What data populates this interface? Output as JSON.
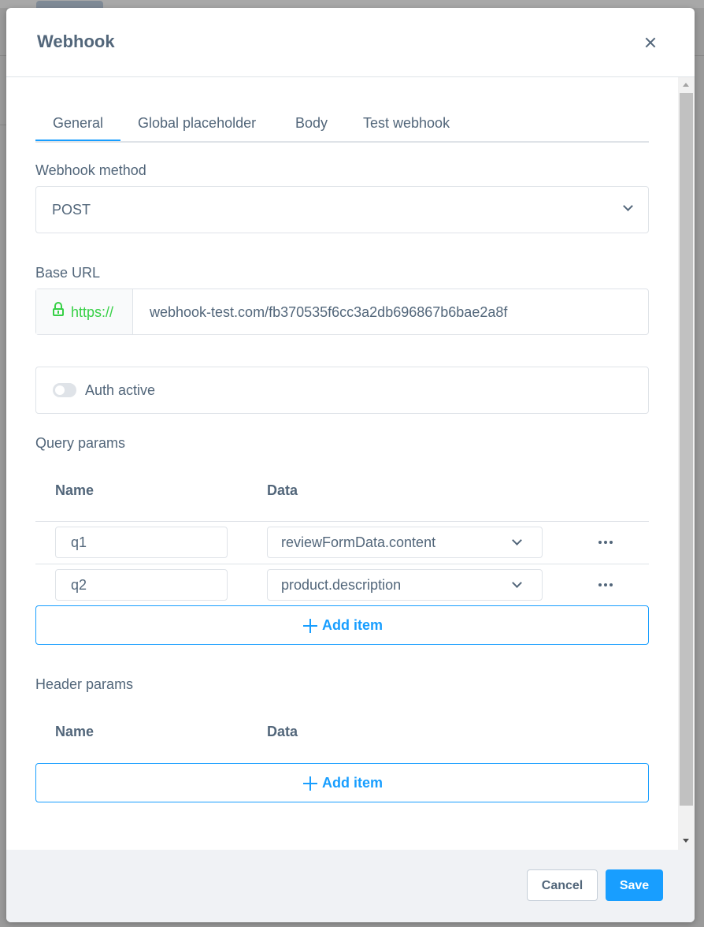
{
  "modal": {
    "title": "Webhook"
  },
  "tabs": [
    {
      "label": "General",
      "active": true
    },
    {
      "label": "Global placeholder",
      "active": false
    },
    {
      "label": "Body",
      "active": false
    },
    {
      "label": "Test webhook",
      "active": false
    }
  ],
  "method": {
    "label": "Webhook method",
    "value": "POST"
  },
  "base_url": {
    "label": "Base URL",
    "prefix": "https://",
    "value": "webhook-test.com/fb370535f6cc3a2db696867b6bae2a8f"
  },
  "auth": {
    "label": "Auth active",
    "enabled": false
  },
  "query_params": {
    "title": "Query params",
    "col_name": "Name",
    "col_data": "Data",
    "rows": [
      {
        "name": "q1",
        "data": "reviewFormData.content"
      },
      {
        "name": "q2",
        "data": "product.description"
      }
    ],
    "add_label": "Add item"
  },
  "header_params": {
    "title": "Header params",
    "col_name": "Name",
    "col_data": "Data",
    "add_label": "Add item"
  },
  "footer": {
    "cancel_label": "Cancel",
    "save_label": "Save"
  },
  "colors": {
    "primary": "#189eff",
    "text": "#52667a",
    "secure": "#37d046",
    "border": "#dfe3e8"
  },
  "icons": [
    "close-icon",
    "chevron-down-icon",
    "lock-icon",
    "more-icon",
    "plus-icon"
  ]
}
